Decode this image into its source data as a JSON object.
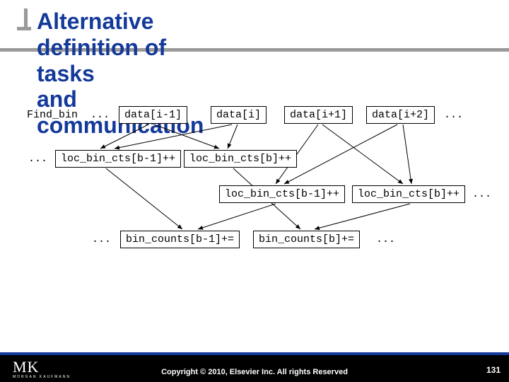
{
  "title_line1": "Alternative definition of tasks",
  "title_line2": "and communication",
  "diagram": {
    "find_bin": "Find_bin",
    "dots": "...",
    "row1": {
      "b0": "data[i-1]",
      "b1": "data[i]",
      "b2": "data[i+1]",
      "b3": "data[i+2]"
    },
    "row2": {
      "b0": "loc_bin_cts[b-1]++",
      "b1": "loc_bin_cts[b]++"
    },
    "row3": {
      "b0": "loc_bin_cts[b-1]++",
      "b1": "loc_bin_cts[b]++"
    },
    "row4": {
      "b0": "bin_counts[b-1]+=",
      "b1": "bin_counts[b]+="
    }
  },
  "footer": {
    "logo_main": "MK",
    "logo_sub": "MORGAN KAUFMANN",
    "copyright": "Copyright © 2010, Elsevier Inc. All rights Reserved",
    "page": "131"
  }
}
